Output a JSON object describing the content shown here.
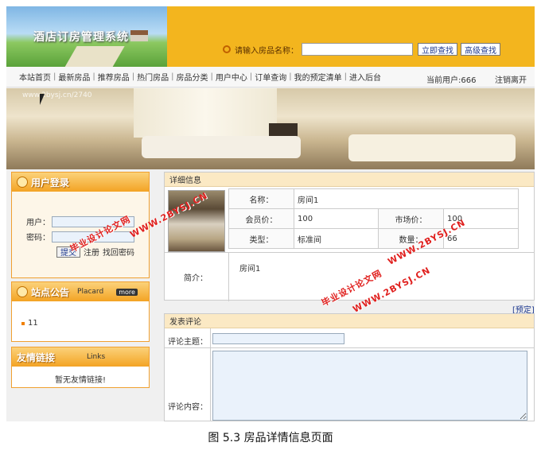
{
  "header": {
    "logo_title": "酒店订房管理系统",
    "search_label": "请输入房品名称：",
    "search_placeholder": "",
    "search_button": "立即查找",
    "advanced_button": "高级查找"
  },
  "nav": {
    "items": [
      "本站首页",
      "最新房品",
      "推荐房品",
      "热门房品",
      "房品分类",
      "用户中心",
      "订单查询",
      "我的预定清单",
      "进入后台"
    ],
    "current_user": "当前用户:666",
    "logout": "注销离开"
  },
  "banner": {
    "watermark": "www.2bysj.cn/2740"
  },
  "login": {
    "title": "用户登录",
    "user_label": "用户：",
    "password_label": "密码：",
    "submit": "提交",
    "register": "注册",
    "forgot": "找回密码"
  },
  "notice": {
    "title": "站点公告",
    "en": "Placard",
    "more": "more",
    "items": [
      "11"
    ]
  },
  "links": {
    "title": "友情链接",
    "en": "Links",
    "empty": "暂无友情链接!"
  },
  "detail": {
    "title": "详细信息",
    "name_label": "名称：",
    "name": "房间1",
    "member_price_label": "会员价：",
    "member_price": "100",
    "market_price_label": "市场价：",
    "market_price": "100",
    "type_label": "类型：",
    "type": "标准间",
    "quantity_label": "数量：",
    "quantity": "66",
    "intro_label": "简介：",
    "intro": "房间1",
    "book": "[预定]"
  },
  "comment": {
    "title": "发表评论",
    "subject_label": "评论主题：",
    "body_label": "评论内容："
  },
  "watermarks": [
    "WWW.2BYSJ.CN",
    "毕业设计论文网"
  ],
  "caption": "图 5.3 房品详情信息页面",
  "colors": {
    "header": "#f3b51e",
    "accent": "#f0a030",
    "watermark": "#e0201e",
    "link": "#1f3a8f"
  }
}
